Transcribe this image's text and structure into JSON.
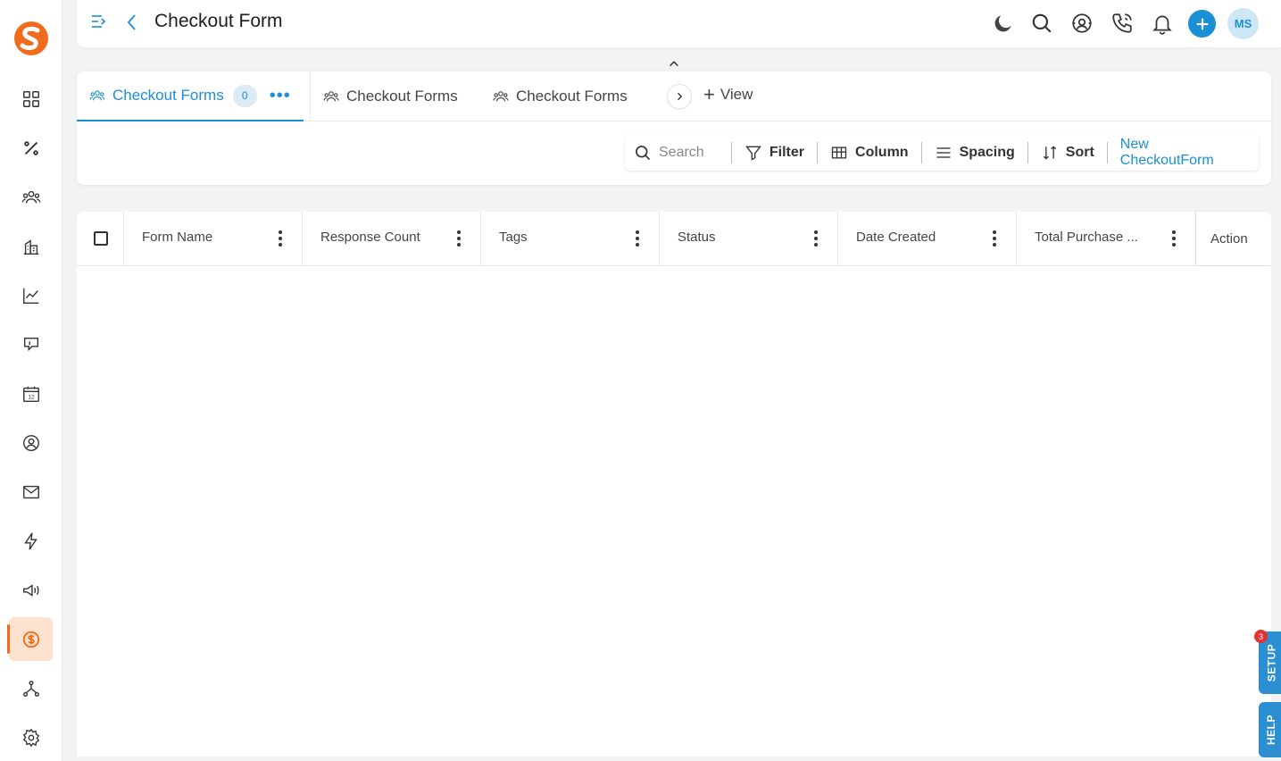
{
  "app": {
    "title": "Checkout Form",
    "brand_color": "#f26b1d",
    "accent_color": "#1a8fd6"
  },
  "sidebar": {
    "items": [
      {
        "icon": "dashboard-grid-icon",
        "active": false
      },
      {
        "icon": "percent-icon",
        "active": false
      },
      {
        "icon": "users-icon",
        "active": false
      },
      {
        "icon": "building-icon",
        "active": false
      },
      {
        "icon": "line-chart-icon",
        "active": false
      },
      {
        "icon": "chat-thumb-icon",
        "active": false
      },
      {
        "icon": "calendar-icon",
        "active": false
      },
      {
        "icon": "user-circle-icon",
        "active": false
      },
      {
        "icon": "mail-icon",
        "active": false
      },
      {
        "icon": "lightning-icon",
        "active": false
      },
      {
        "icon": "megaphone-icon",
        "active": false
      },
      {
        "icon": "dollar-circle-icon",
        "active": true
      },
      {
        "icon": "hierarchy-icon",
        "active": false
      },
      {
        "icon": "settings-gear-icon",
        "active": false
      }
    ]
  },
  "header": {
    "avatar_initials": "MS"
  },
  "tabs": {
    "items": [
      {
        "label": "Checkout Forms",
        "count": "0",
        "active": true
      },
      {
        "label": "Checkout Forms",
        "active": false
      },
      {
        "label": "Checkout Forms",
        "active": false
      }
    ],
    "add_view_label": "View"
  },
  "toolbar": {
    "search_placeholder": "Search",
    "filter_label": "Filter",
    "column_label": "Column",
    "spacing_label": "Spacing",
    "sort_label": "Sort",
    "new_label": "New CheckoutForm"
  },
  "table": {
    "columns": [
      "Form Name",
      "Response Count",
      "Tags",
      "Status",
      "Date Created",
      "Total Purchase ...",
      "Action"
    ],
    "rows": []
  },
  "floating": {
    "setup_label": "SETUP",
    "setup_badge": "3",
    "help_label": "HELP"
  }
}
